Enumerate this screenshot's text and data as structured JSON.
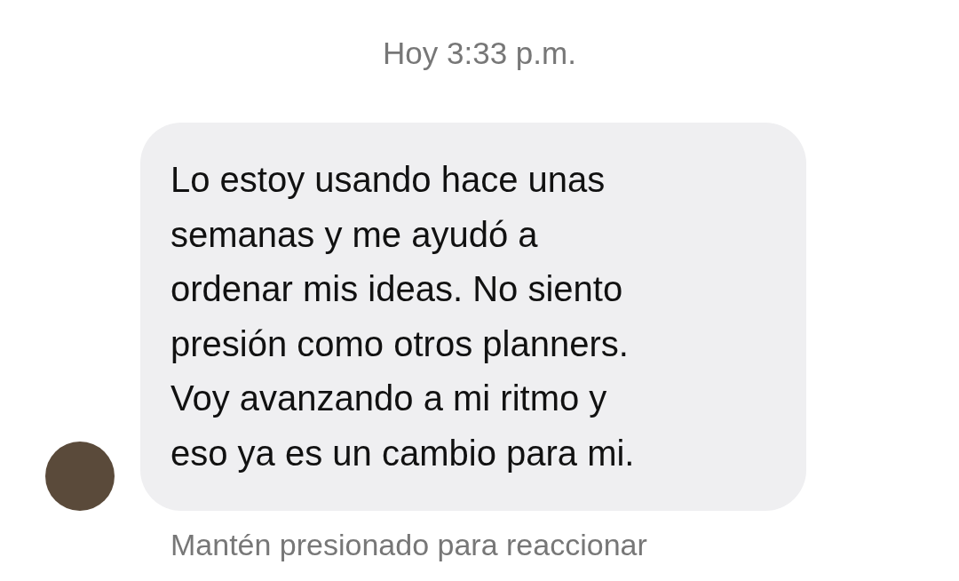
{
  "timestamp": "Hoy 3:33 p.m.",
  "message": {
    "lines": [
      "Lo estoy usando hace unas",
      "semanas y me ayudó a",
      "ordenar mis ideas. No siento",
      "presión como otros planners.",
      "Voy avanzando a mi ritmo y",
      "eso ya es un cambio para mi."
    ]
  },
  "hint": "Mantén presionado para reaccionar"
}
